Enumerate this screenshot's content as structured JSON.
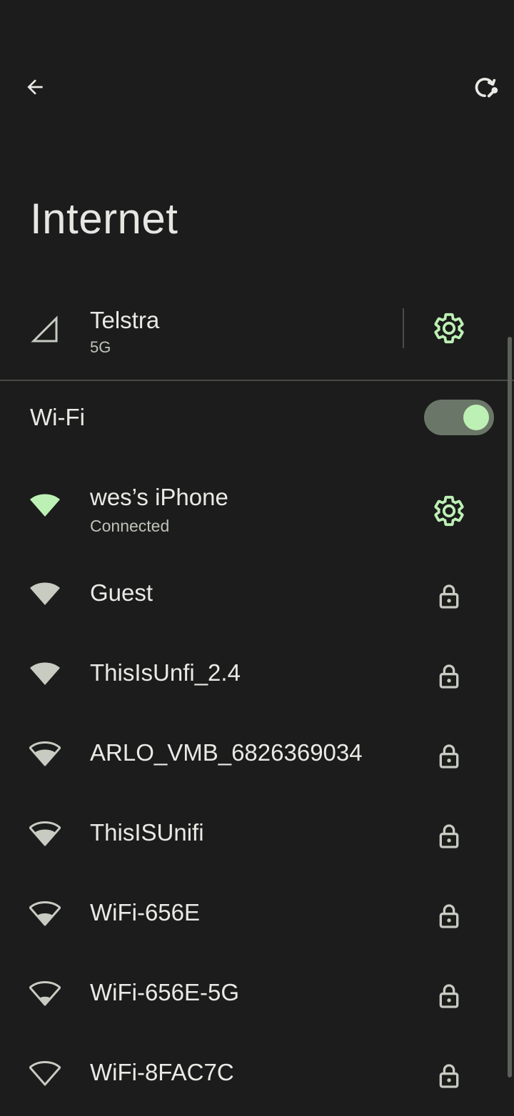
{
  "header": {
    "back_icon": "arrow-back-icon",
    "reset_icon": "network-reset-icon",
    "title": "Internet"
  },
  "mobile": {
    "carrier": "Telstra",
    "network_type": "5G",
    "signal_icon": "cell-signal-icon",
    "settings_icon": "gear-icon"
  },
  "wifi": {
    "label": "Wi-Fi",
    "enabled": true,
    "networks": [
      {
        "ssid": "wes’s iPhone",
        "status": "Connected",
        "trailing": "gear-icon"
      },
      {
        "ssid": "Guest",
        "trailing": "lock-icon"
      },
      {
        "ssid": "ThisIsUnfi_2.4",
        "trailing": "lock-icon"
      },
      {
        "ssid": "ARLO_VMB_6826369034",
        "trailing": "lock-icon"
      },
      {
        "ssid": "ThisISUnifi",
        "trailing": "lock-icon"
      },
      {
        "ssid": "WiFi-656E",
        "trailing": "lock-icon"
      },
      {
        "ssid": "WiFi-656E-5G",
        "trailing": "lock-icon"
      },
      {
        "ssid": "WiFi-8FAC7C",
        "trailing": "lock-icon"
      }
    ]
  },
  "colors": {
    "background": "#1b1c1b",
    "accent": "#bdf0b5",
    "text": "#e9eae5"
  }
}
